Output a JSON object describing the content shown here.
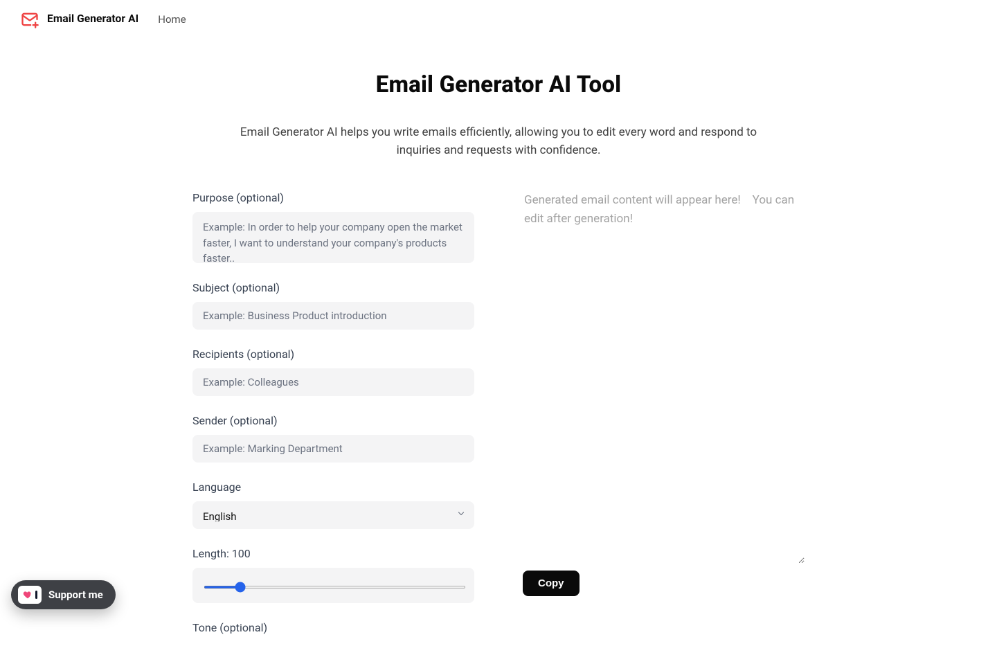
{
  "brand": {
    "name": "Email Generator AI"
  },
  "nav": {
    "home": "Home"
  },
  "hero": {
    "title": "Email Generator AI Tool",
    "subtitle": "Email Generator AI helps you write emails efficiently, allowing you to edit every word and respond to inquiries and requests with confidence."
  },
  "form": {
    "purpose": {
      "label": "Purpose (optional)",
      "placeholder": "Example: In order to help your company open the market faster, I want to understand your company's products faster.."
    },
    "subject": {
      "label": "Subject (optional)",
      "placeholder": "Example: Business Product introduction"
    },
    "recipients": {
      "label": "Recipients (optional)",
      "placeholder": "Example: Colleagues"
    },
    "sender": {
      "label": "Sender (optional)",
      "placeholder": "Example: Marking Department"
    },
    "language": {
      "label": "Language",
      "value": "English"
    },
    "length": {
      "label_prefix": "Length: ",
      "value": 100,
      "min": 0,
      "max": 800
    },
    "tone": {
      "label": "Tone (optional)"
    }
  },
  "result": {
    "placeholder": "Generated email content will appear here!    You can edit after generation!"
  },
  "buttons": {
    "copy": "Copy"
  },
  "support": {
    "label": "Support me"
  }
}
